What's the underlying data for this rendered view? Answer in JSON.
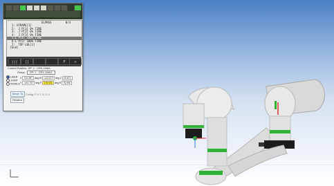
{
  "pendant": {
    "status_text": "",
    "program_header": {
      "title": "ELPRGS",
      "line": "0/4"
    },
    "program_lines": [
      "  1: UFRAME[1]",
      "  2:  J P[1] 0% FINE",
      "  3:  J P[2] 0% FINE",
      "  4:  J P[3] 0% FINE",
      "  5:L P[4] 100% FINE",
      "  6:L P[5] 100% FINE",
      "  7:  TOP LBL[1]",
      " [End]"
    ],
    "selected_line": 4,
    "buttons": [
      "|||",
      "[]",
      "",
      "",
      "F",
      ">"
    ],
    "position_header": "Current Position, GP: 1 - CRX-10iA/L",
    "group_label": "Group",
    "group_value": "GP: 1 - CRX-10iA/L",
    "frames": [
      "USER",
      "JOINT",
      "WORLD"
    ],
    "active_frame": "USER",
    "x_label": "X",
    "x_value": "734.387",
    "x_unit": "deg",
    "y_label": "Y",
    "y_value": "-444.757",
    "y_unit": "deg",
    "w_label": "W",
    "w_value": "-143.572",
    "w_unit": "deg",
    "p_label": "P",
    "p_value": "178.031",
    "p_unit": "deg",
    "z_label": "Z",
    "z_value": "20.671",
    "z_unit": "deg",
    "r_label": "R",
    "r_value": "76.996",
    "r_unit": "deg",
    "move_to_label": "Move To",
    "relative_label": "Relative",
    "config_text": "Config: F U T, 0, 0, 0"
  },
  "colors": {
    "accent_green": "#2fb236",
    "robot_white": "#e6e6e6",
    "robot_black": "#1c1c1c"
  }
}
